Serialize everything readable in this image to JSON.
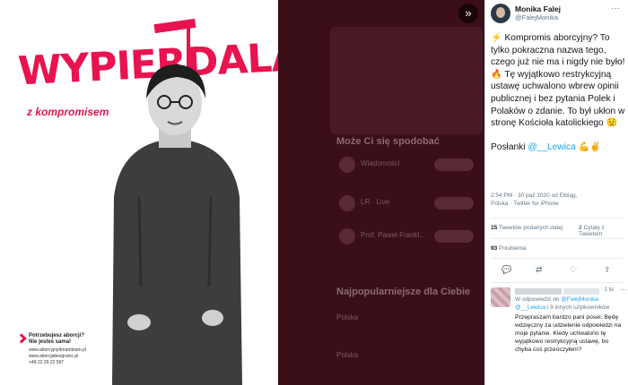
{
  "poster": {
    "headline": "WYPIERDALAĆ!",
    "subline": "z kompromisem",
    "footer_title_1": "Potrzebujesz aborcji?",
    "footer_title_2": "Nie jesteś sama!",
    "link_1": "www.aborcyjnydreamteam.pl",
    "link_2": "www.aborcjabezgranic.pl",
    "phone": "+48 22 29 22 597",
    "accent_color": "#e8134f"
  },
  "viewer": {
    "expand_icon": "»"
  },
  "background": {
    "heading_1": "Może Ci się spodobać",
    "suggestions": [
      "Wiadomości",
      "LR · Live",
      "Prof. Paweł Frankl..."
    ],
    "heading_2": "Najpopularniejsze dla Ciebie",
    "trend_label_1": "Polska",
    "trend_label_2": "Polska"
  },
  "tweet": {
    "author_name": "Monika Falej",
    "author_handle": "@FalejMonika",
    "more_icon": "···",
    "line_1": "⚡ Kompromis aborcyjny? To tylko pokraczna nazwa tego, czego już nie ma i nigdy nie było!",
    "line_2": "🔥 Tę wyjątkowo restrykcyjną ustawę uchwalono wbrew opinii publicznej i bez pytania Polek i Polaków o zdanie. To był ukłon w stronę Kościoła katolickiego 😟",
    "line_3_prefix": "Posłanki ",
    "mention": "@__Lewica",
    "line_3_suffix": " 💪✌",
    "meta_line_1": "2:54 PM · 30 paź 2020 od Elbląg,",
    "meta_line_2": "Polska · Twitter for iPhone",
    "retweets_count": "15",
    "retweets_label": "Tweetów podanych dalej",
    "quotes_count": "2",
    "quotes_label": "Cytaty z Tweetem",
    "likes_count": "93",
    "likes_label": "Polubienia"
  },
  "actions": {
    "reply_icon": "💬",
    "retweet_icon": "⇄",
    "like_icon": "♡",
    "share_icon": "⇪"
  },
  "reply": {
    "time": "· 1 lis",
    "more_icon": "···",
    "reply_to_prefix": "W odpowiedzi do ",
    "reply_to_user": "@FalejMonika",
    "reply_to_user_2": "@__Lewica",
    "reply_to_suffix": " i 9 innych użytkowników",
    "text": "Przepraszam bardzo pani posel. Będę wdzięczny za udzielenie odpowiedzi na moje pytanie. Kiedy uchwalono tę wyjątkowo restrykcyjną ustawę, bo chyba coś przeoczyłem?"
  }
}
